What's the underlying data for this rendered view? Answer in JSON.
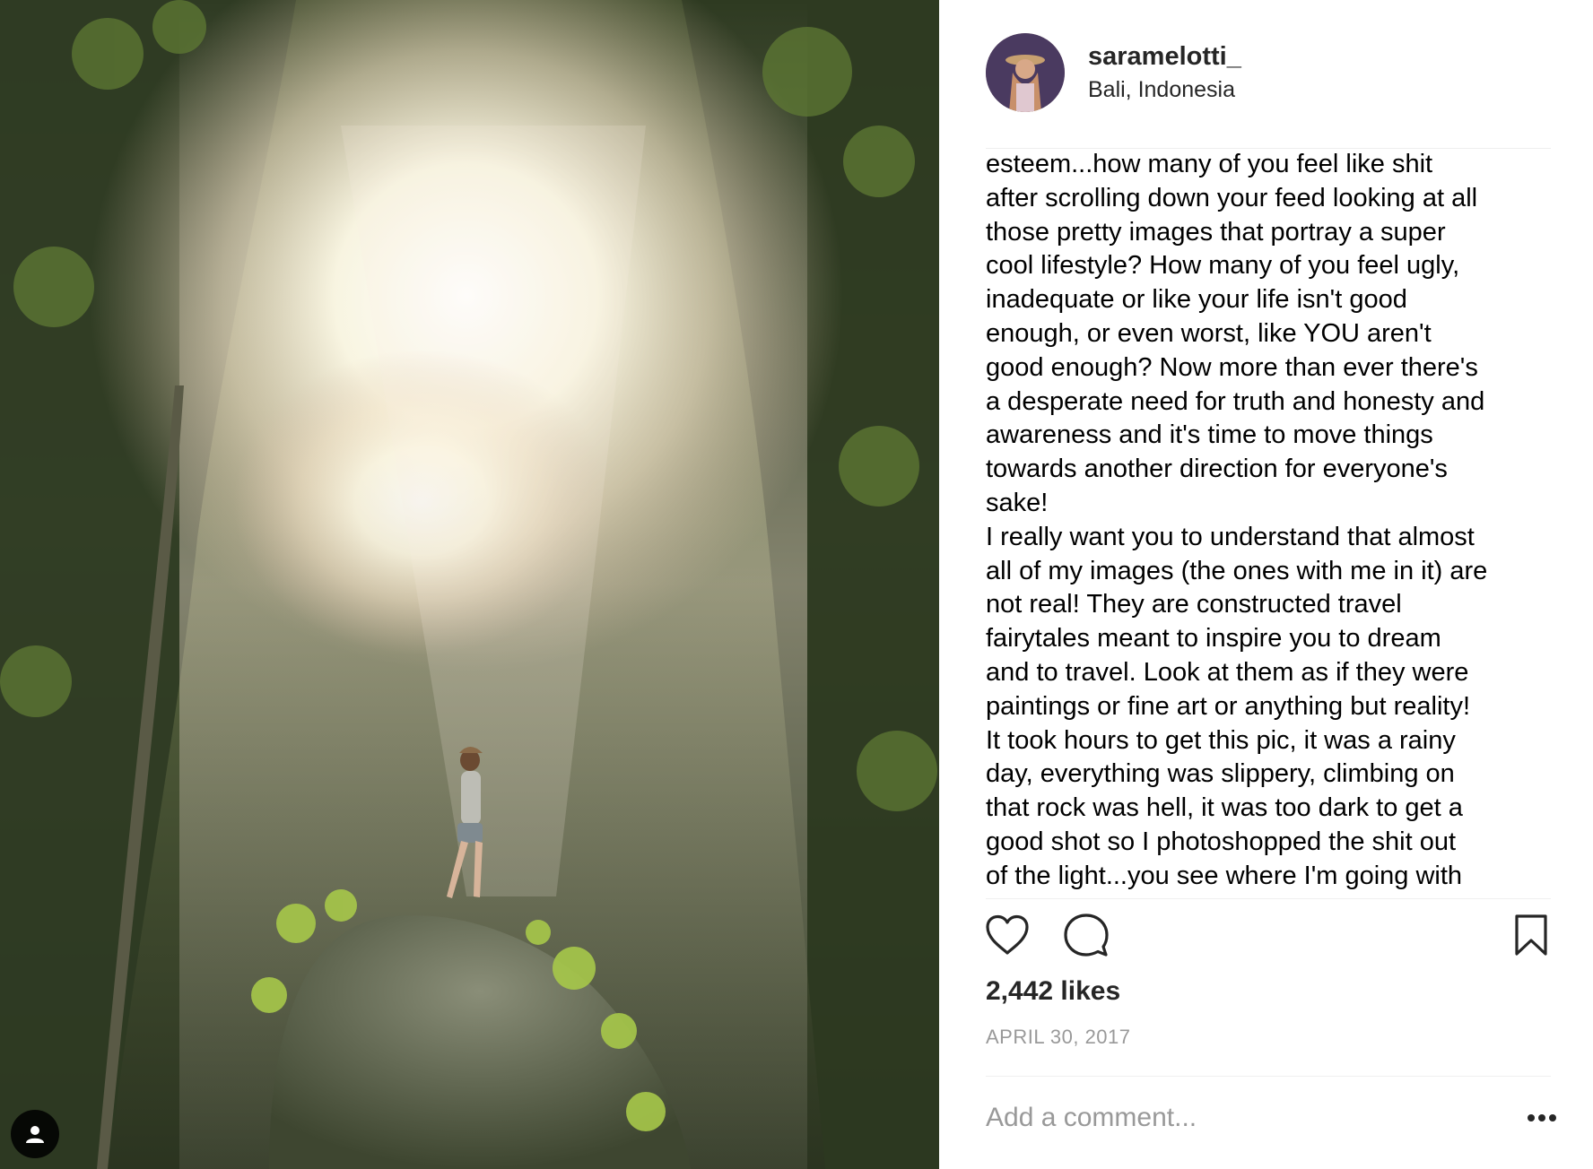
{
  "post": {
    "username": "saramelotti_",
    "location": "Bali, Indonesia",
    "caption": "esteem...how many of you feel like shit\nafter scrolling down your feed looking at all\nthose pretty images that portray a super\ncool lifestyle? How many of you feel ugly,\ninadequate or like your life isn't good\nenough, or even worst, like YOU aren't\ngood enough? Now more than ever there's\na desperate need for truth and honesty and\nawareness and it's time to move things\ntowards another direction for everyone's\nsake!\nI really want you to understand that almost\nall of my images (the ones with me in it) are\nnot real! They are constructed travel\nfairytales meant to inspire you to dream\nand to travel. Look at them as if they were\npaintings or fine art or anything but reality!\nIt took hours to get this pic, it was a rainy\nday, everything was slippery, climbing on\nthat rock was hell, it was too dark to get a\ngood shot so I photoshopped the shit out\nof the light...you see where I'm going with",
    "likes": "2,442 likes",
    "date": "APRIL 30, 2017"
  },
  "comment": {
    "placeholder": "Add a comment..."
  },
  "icons": {
    "like": "heart-icon",
    "comment": "comment-bubble-icon",
    "save": "bookmark-icon",
    "more": "more-options-icon",
    "tagged": "user-tag-icon"
  },
  "colors": {
    "text": "#262626",
    "muted": "#999999",
    "divider": "#efefef"
  }
}
